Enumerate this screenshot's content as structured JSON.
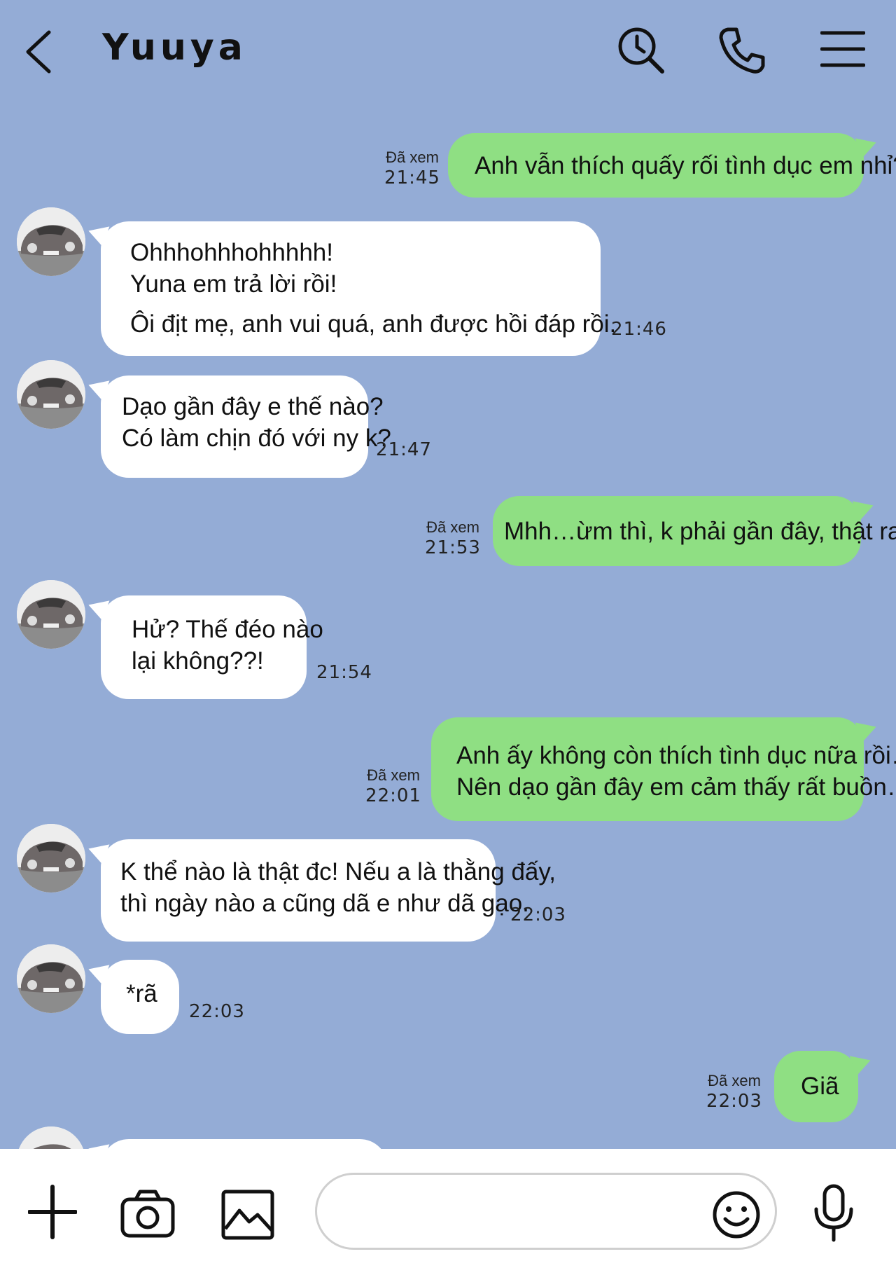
{
  "header": {
    "contact_name": "Yuuya",
    "back_icon": "chevron-left-icon",
    "search_icon": "search-clock-icon",
    "call_icon": "phone-icon",
    "menu_icon": "hamburger-menu-icon"
  },
  "colors": {
    "background": "#94acd6",
    "outgoing_bubble": "#8fdf83",
    "incoming_bubble": "#ffffff"
  },
  "messages": [
    {
      "direction": "out",
      "lines": [
        "Anh vẫn thích quấy rối tình dục em nhỉ?"
      ],
      "read": "Đã xem",
      "time": "21:45"
    },
    {
      "direction": "in",
      "lines": [
        "Ohhhohhhohhhhh!",
        "Yuna em trả lời rồi!",
        "Ôi địt mẹ, anh vui quá, anh được hồi đáp rồi."
      ],
      "time": "21:46"
    },
    {
      "direction": "in",
      "lines": [
        "Dạo gần đây e thế nào?",
        "Có làm chịn đó với ny k?"
      ],
      "time": "21:47"
    },
    {
      "direction": "out",
      "lines": [
        "Mhh…ừm thì, k phải gần đây, thật ra…"
      ],
      "read": "Đã xem",
      "time": "21:53"
    },
    {
      "direction": "in",
      "lines": [
        "Hử? Thế đéo nào",
        "lại không??!"
      ],
      "time": "21:54"
    },
    {
      "direction": "out",
      "lines": [
        "Anh ấy không còn thích tình dục nữa rồi…",
        "Nên dạo gần đây em cảm thấy rất buồn…"
      ],
      "read": "Đã xem",
      "time": "22:01"
    },
    {
      "direction": "in",
      "lines": [
        "K thể nào là thật đc! Nếu a là thằng đấy,",
        "thì ngày nào a cũng dã e như dã gạo."
      ],
      "time": "22:03"
    },
    {
      "direction": "in",
      "lines": [
        "*rã"
      ],
      "time": "22:03"
    },
    {
      "direction": "out",
      "lines": [
        "Giã"
      ],
      "read": "Đã xem",
      "time": "22:03"
    }
  ],
  "input_bar": {
    "plus_icon": "plus-icon",
    "camera_icon": "camera-icon",
    "image_icon": "image-icon",
    "emoji_icon": "smiley-icon",
    "mic_icon": "microphone-icon",
    "message_value": ""
  }
}
